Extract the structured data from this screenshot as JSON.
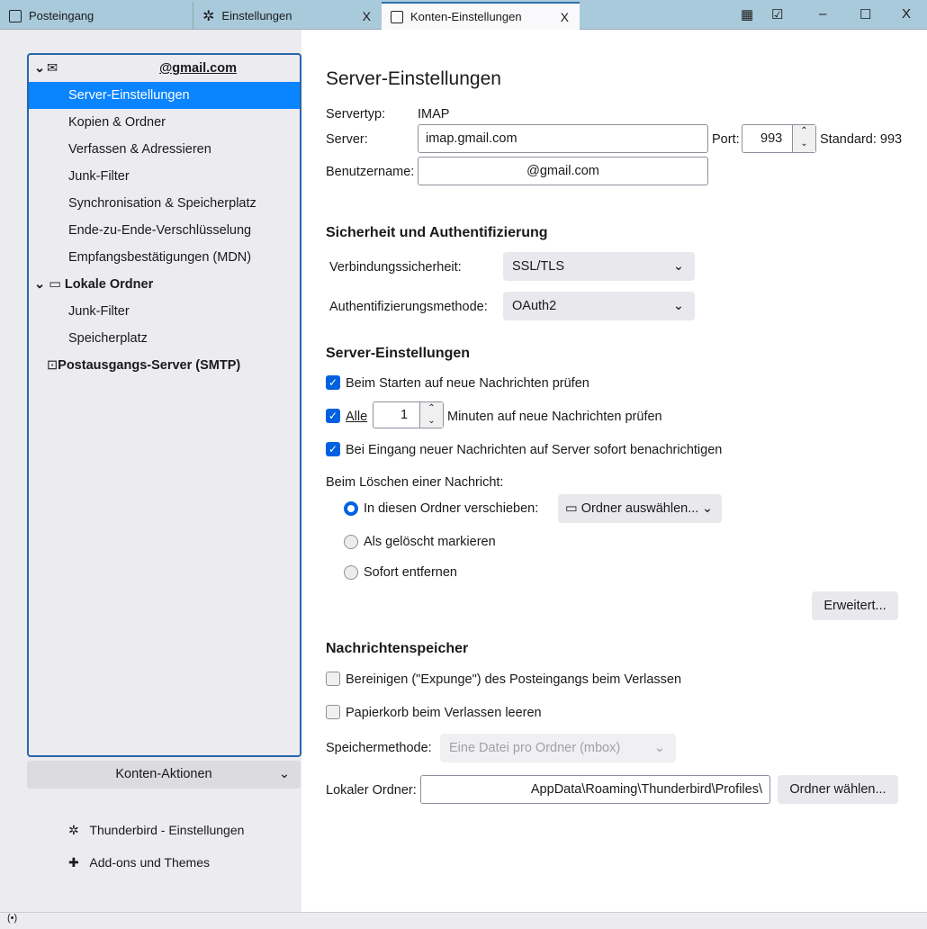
{
  "tabs": [
    {
      "label": "Posteingang"
    },
    {
      "label": "Einstellungen"
    },
    {
      "label": "Konten-Einstellungen"
    }
  ],
  "window": {
    "minimize": "–",
    "maximize": "☐",
    "close": "X",
    "tab_close": "X"
  },
  "sidebar": {
    "account": "@gmail.com",
    "account_items": [
      "Server-Einstellungen",
      "Kopien & Ordner",
      "Verfassen & Adressieren",
      "Junk-Filter",
      "Synchronisation & Speicherplatz",
      "Ende-zu-Ende-Verschlüsselung",
      "Empfangsbestätigungen (MDN)"
    ],
    "local": "Lokale Ordner",
    "local_items": [
      "Junk-Filter",
      "Speicherplatz"
    ],
    "smtp": "Postausgangs-Server (SMTP)",
    "actions": "Konten-Aktionen",
    "footer": [
      "Thunderbird - Einstellungen",
      "Add-ons und Themes"
    ]
  },
  "main": {
    "title": "Server-Einstellungen",
    "servertype_label": "Servertyp:",
    "servertype": "IMAP",
    "server_label": "Server:",
    "server": "imap.gmail.com",
    "port_label": "Port:",
    "port": "993",
    "standard": "Standard: 993",
    "user_label": "Benutzername:",
    "user": "@gmail.com",
    "security_heading": "Sicherheit und Authentifizierung",
    "conn_label": "Verbindungssicherheit:",
    "conn": "SSL/TLS",
    "auth_label": "Authentifizierungsmethode:",
    "auth": "OAuth2",
    "server_heading": "Server-Einstellungen",
    "check_startup": "Beim Starten auf neue Nachrichten prüfen",
    "check_every_pre": "Alle",
    "check_every_value": "1",
    "check_every_post": "Minuten auf neue Nachrichten prüfen",
    "notify": "Bei Eingang neuer Nachrichten auf Server sofort benachrichtigen",
    "delete_label": "Beim Löschen einer Nachricht:",
    "radio_move": "In diesen Ordner verschieben:",
    "folder_select": "Ordner auswählen...",
    "radio_mark": "Als gelöscht markieren",
    "radio_remove": "Sofort entfernen",
    "advanced": "Erweitert...",
    "storage_heading": "Nachrichtenspeicher",
    "expunge": "Bereinigen (\"Expunge\") des Posteingangs beim Verlassen",
    "empty_trash": "Papierkorb beim Verlassen leeren",
    "storage_method_label": "Speichermethode:",
    "storage_method": "Eine Datei pro Ordner (mbox)",
    "local_dir_label": "Lokaler Ordner:",
    "local_dir": "AppData\\Roaming\\Thunderbird\\Profiles\\",
    "choose_folder": "Ordner wählen..."
  }
}
